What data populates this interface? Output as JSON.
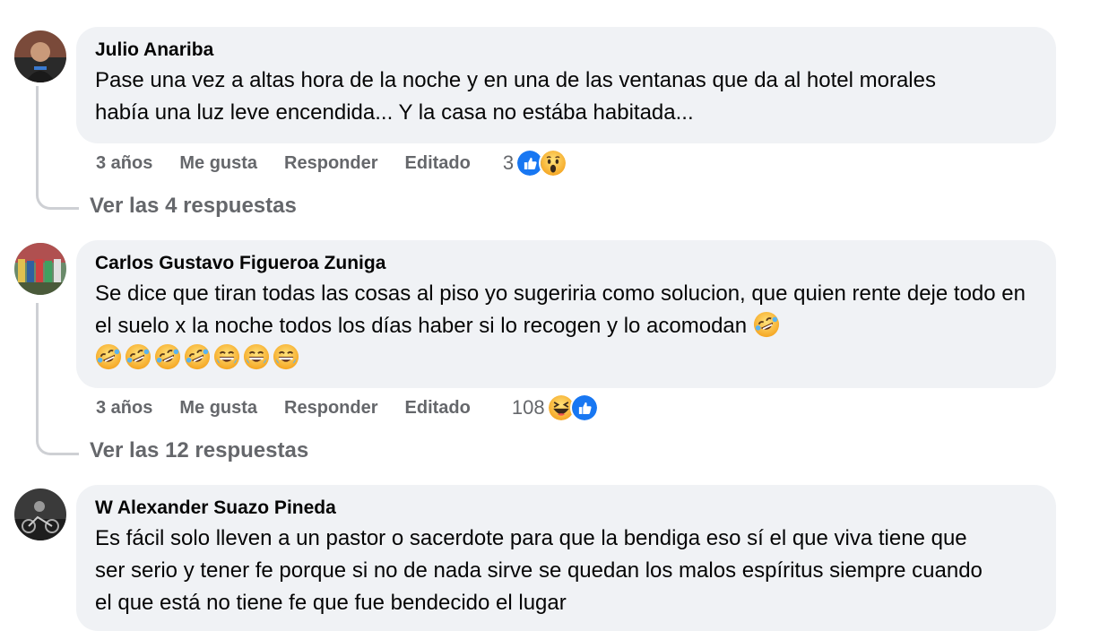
{
  "comments": [
    {
      "author": "Julio Anariba",
      "text": "Pase una vez a altas hora de la noche y en una de las ventanas que da al hotel morales había una luz leve encendida... Y la casa no estába habitada...",
      "time": "3 años",
      "like": "Me gusta",
      "reply": "Responder",
      "edited": "Editado",
      "reaction_count": "3",
      "reactions": [
        "like-icon",
        "wow-icon"
      ],
      "replies_link": "Ver las 4 respuestas"
    },
    {
      "author": "Carlos Gustavo Figueroa Zuniga",
      "text": "Se dice que tiran todas las cosas al piso yo sugeriria como solucion, que quien rente deje todo en el suelo x la noche todos los días haber si lo recogen y lo acomodan",
      "emoji_line": [
        "rofl",
        "rofl",
        "rofl",
        "rofl",
        "grin-sweat",
        "grin-sweat",
        "grin-sweat"
      ],
      "trailing_emoji": "rofl",
      "time": "3 años",
      "like": "Me gusta",
      "reply": "Responder",
      "edited": "Editado",
      "reaction_count": "108",
      "reactions": [
        "haha-icon",
        "like-icon"
      ],
      "replies_link": "Ver las 12 respuestas"
    },
    {
      "author": "W Alexander Suazo Pineda",
      "text": "Es fácil solo lleven a un pastor o sacerdote para que la bendiga eso sí el que viva tiene que ser serio y tener fe porque si no de nada sirve se quedan los malos espíritus siempre cuando el que está no tiene fe que fue bendecido el lugar"
    }
  ],
  "colors": {
    "bubble": "#f0f2f5",
    "meta_text": "#65676b",
    "like_blue": "#1877f2",
    "emoji_yellow": "#f7b928"
  }
}
